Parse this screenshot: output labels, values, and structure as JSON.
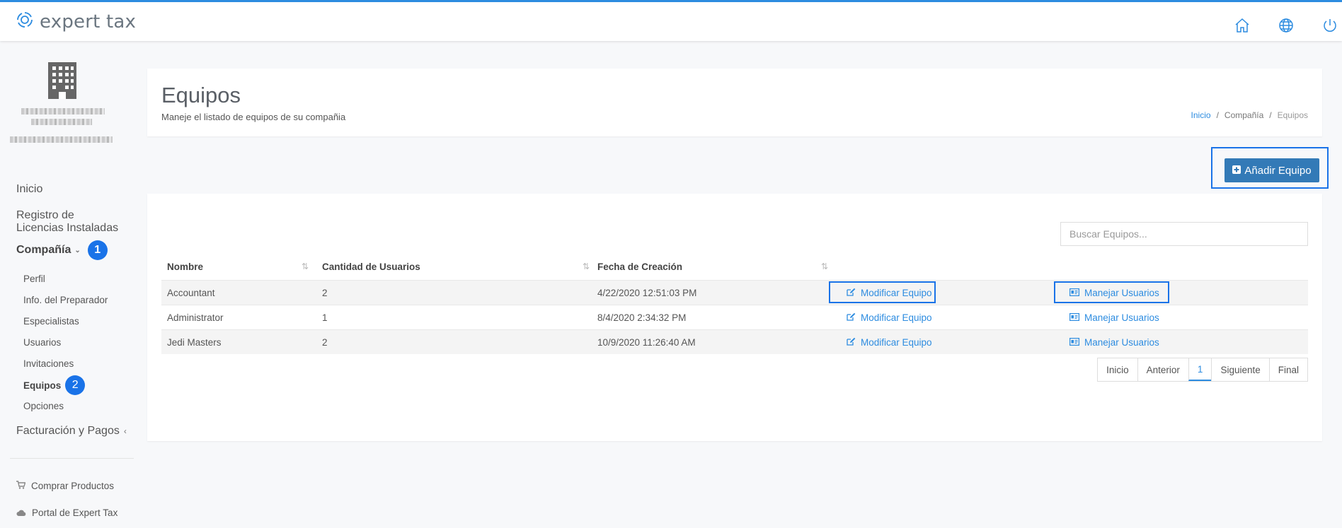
{
  "app": {
    "logo_text": "expert tax"
  },
  "topbar": {
    "icons": [
      "home-icon",
      "globe-icon",
      "power-icon"
    ]
  },
  "sidebar": {
    "company_icon": "building-icon",
    "nav": {
      "inicio": "Inicio",
      "registro": "Registro de Licencias Instaladas",
      "compania": "Compañía",
      "compania_badge": "1",
      "sub": [
        "Perfil",
        "Info. del Preparador",
        "Especialistas",
        "Usuarios",
        "Invitaciones",
        "Equipos",
        "Opciones"
      ],
      "equipos_badge": "2",
      "facturacion": "Facturación y Pagos"
    },
    "bottom": {
      "comprar": "Comprar Productos",
      "portal": "Portal de Expert Tax"
    }
  },
  "header": {
    "title": "Equipos",
    "subtitle": "Maneje el listado de equipos de su compañia",
    "breadcrumb": [
      "Inicio",
      "Compañía",
      "Equipos"
    ],
    "separator": "/"
  },
  "add_button": {
    "label": "Añadir Equipo"
  },
  "search": {
    "placeholder": "Buscar Equipos..."
  },
  "table": {
    "columns": [
      "Nombre",
      "Cantidad de Usuarios",
      "Fecha de Creación"
    ],
    "rows": [
      {
        "nombre": "Accountant",
        "cantidad": "2",
        "fecha": "4/22/2020 12:51:03 PM",
        "modificar": "Modificar Equipo",
        "manejar": "Manejar Usuarios"
      },
      {
        "nombre": "Administrator",
        "cantidad": "1",
        "fecha": "8/4/2020 2:34:32 PM",
        "modificar": "Modificar Equipo",
        "manejar": "Manejar Usuarios"
      },
      {
        "nombre": "Jedi Masters",
        "cantidad": "2",
        "fecha": "10/9/2020 11:26:40 AM",
        "modificar": "Modificar Equipo",
        "manejar": "Manejar Usuarios"
      }
    ]
  },
  "pagination": {
    "first": "Inicio",
    "prev": "Anterior",
    "current": "1",
    "next": "Siguiente",
    "last": "Final"
  },
  "colors": {
    "accent": "#2d8ce0",
    "button": "#337ab7",
    "highlight": "#1a73e8"
  }
}
